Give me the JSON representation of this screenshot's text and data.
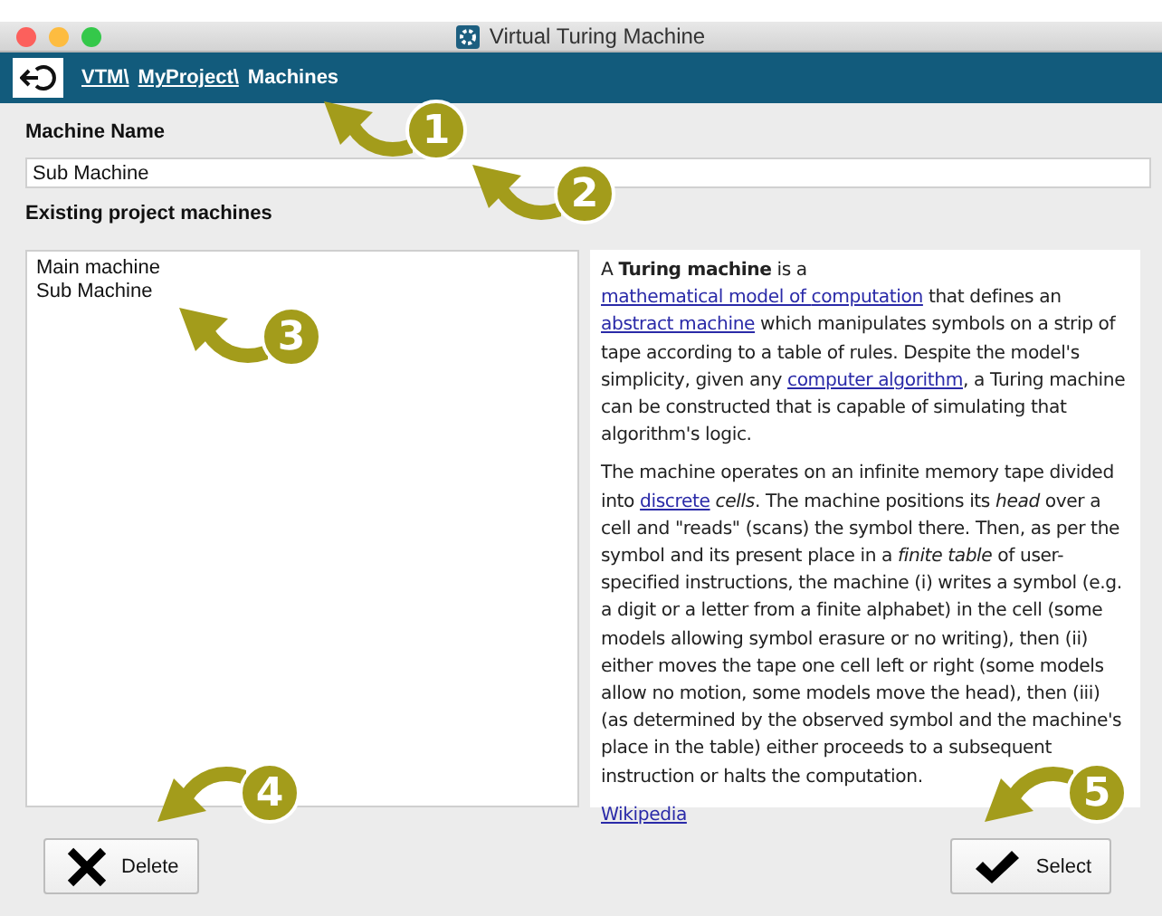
{
  "window": {
    "title": "Virtual Turing Machine"
  },
  "breadcrumb": [
    {
      "label": "VTM\\",
      "kind": "link"
    },
    {
      "label": "MyProject\\",
      "kind": "link"
    },
    {
      "label": "Machines",
      "kind": "current"
    }
  ],
  "machine_name": {
    "label": "Machine Name",
    "value": "Sub Machine"
  },
  "machines": {
    "label": "Existing project machines",
    "items": [
      {
        "label": "Main machine",
        "selected": false
      },
      {
        "label": "Sub Machine",
        "selected": false
      }
    ]
  },
  "article": {
    "paragraphs": [
      [
        {
          "kind": "text",
          "text": "A **Turing machine** is a "
        },
        {
          "kind": "link",
          "text": "mathematical model of "
        },
        {
          "kind": "link",
          "text": "computation"
        },
        {
          "kind": "text",
          "text": " that defines an "
        },
        {
          "kind": "link",
          "text": "abstract machine"
        },
        {
          "kind": "text",
          "text": " which manipulates symbols on a strip of tape according to a table of rules. Despite the model's simplicity, given any "
        },
        {
          "kind": "link",
          "text": "computer algorithm"
        },
        {
          "kind": "text",
          "text": ", a Turing machine can be constructed that is capable of simulating that algorithm's logic."
        }
      ],
      [
        {
          "kind": "text",
          "text": "The machine operates on an infinite memory tape divided into "
        },
        {
          "kind": "link",
          "text": "discrete"
        },
        {
          "kind": "text",
          "text": " *cells*. The machine positions its *head* over a cell and \"reads\" (scans) the symbol there. Then, as per the symbol and its present place in a *finite table* of user-specified instructions, the machine (i) writes a symbol (e.g. a digit or a letter from a finite alphabet) in the cell (some models allowing symbol erasure or no writing), then (ii) either moves the tape one cell left or right (some models allow no motion, some models move the head), then (iii) (as determined by the observed symbol and the machine's place in the table) either proceeds to a subsequent instruction or halts the computation."
        }
      ]
    ],
    "source": "Wikipedia"
  },
  "buttons": [
    {
      "label": "Delete",
      "kind": "delete"
    },
    {
      "label": "Select",
      "kind": "select"
    }
  ],
  "callouts": [
    {
      "number": "1",
      "kind": "up-left"
    },
    {
      "number": "2",
      "kind": "up-left"
    },
    {
      "number": "3",
      "kind": "up-left"
    },
    {
      "number": "4",
      "kind": "down-left"
    },
    {
      "number": "5",
      "kind": "down-left"
    }
  ]
}
